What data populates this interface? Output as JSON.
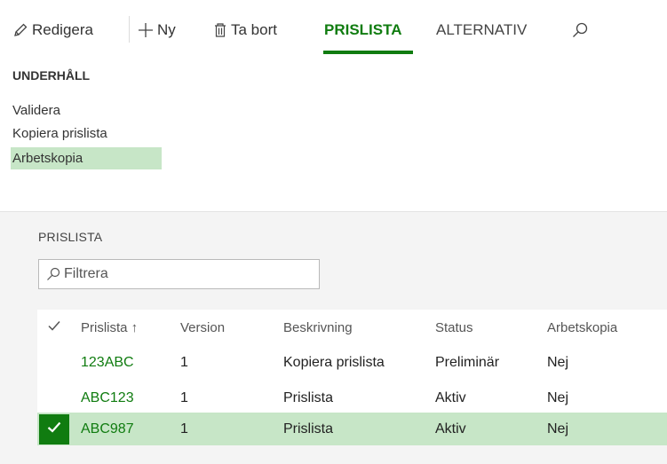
{
  "action_pane": {
    "edit_label": "Redigera",
    "new_label": "Ny",
    "delete_label": "Ta bort",
    "tabs": [
      {
        "label": "PRISLISTA",
        "active": true
      },
      {
        "label": "ALTERNATIV",
        "active": false
      }
    ]
  },
  "ribbon_group": {
    "title": "UNDERHÅLL",
    "items": [
      {
        "label": "Validera",
        "selected": false
      },
      {
        "label": "Kopiera prislista",
        "selected": false
      },
      {
        "label": "Arbetskopia",
        "selected": true
      }
    ]
  },
  "section": {
    "title": "PRISLISTA",
    "filter_placeholder": "Filtrera"
  },
  "grid": {
    "columns": [
      "Prislista ↑",
      "Version",
      "Beskrivning",
      "Status",
      "Arbetskopia"
    ],
    "rows": [
      {
        "prislista": "123ABC",
        "version": "1",
        "beskrivning": "Kopiera prislista",
        "status": "Preliminär",
        "arbetskopia": "Nej",
        "selected": false
      },
      {
        "prislista": "ABC123",
        "version": "1",
        "beskrivning": "Prislista",
        "status": "Aktiv",
        "arbetskopia": "Nej",
        "selected": false
      },
      {
        "prislista": "ABC987",
        "version": "1",
        "beskrivning": "Prislista",
        "status": "Aktiv",
        "arbetskopia": "Nej",
        "selected": true
      }
    ]
  },
  "colors": {
    "accent": "#107c10",
    "selection": "#c7e6c7",
    "background_gray": "#f4f4f4"
  }
}
